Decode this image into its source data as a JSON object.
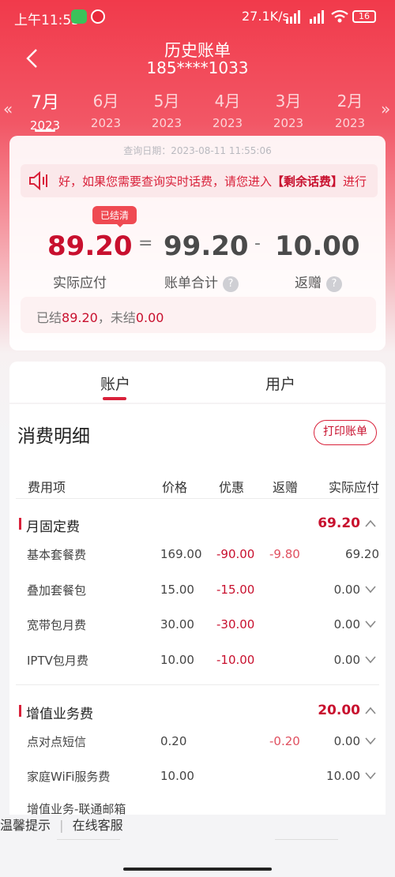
{
  "status_bar": {
    "time": "上午11:55",
    "speed": "27.1K/s",
    "battery": "16"
  },
  "header": {
    "title": "历史账单",
    "phone": "185****1033"
  },
  "months": [
    {
      "month": "7月",
      "year": "2023"
    },
    {
      "month": "6月",
      "year": "2023"
    },
    {
      "month": "5月",
      "year": "2023"
    },
    {
      "month": "4月",
      "year": "2023"
    },
    {
      "month": "3月",
      "year": "2023"
    },
    {
      "month": "2月",
      "year": "2023"
    }
  ],
  "summary": {
    "query_date": "查询日期：2023-08-11 11:55:06",
    "notice": "好，如果您需要查询实时话费，请您进入",
    "notice_link": "【剩余话费】",
    "notice_tail": "进行",
    "badge": "已结清",
    "actual": "89.20",
    "equals": "=",
    "total": "99.20",
    "minus": "-",
    "rebate": "10.00",
    "actual_label": "实际应付",
    "total_label": "账单合计",
    "rebate_label": "返赠",
    "settled_prefix": "已结",
    "settled_value": "89.20",
    "unsettled_prefix": "，未结",
    "unsettled_value": "0.00"
  },
  "tabs": {
    "account": "账户",
    "user": "用户"
  },
  "detail": {
    "title": "消费明细",
    "print_button": "打印账单",
    "columns": [
      "费用项",
      "价格",
      "优惠",
      "返赠",
      "实际应付"
    ],
    "sections": [
      {
        "name": "月固定费",
        "total": "69.20",
        "rows": [
          {
            "item": "基本套餐费",
            "price": "169.00",
            "discount": "-90.00",
            "rebate": "-9.80",
            "actual": "69.20"
          },
          {
            "item": "叠加套餐包",
            "price": "15.00",
            "discount": "-15.00",
            "rebate": "",
            "actual": "0.00"
          },
          {
            "item": "宽带包月费",
            "price": "30.00",
            "discount": "-30.00",
            "rebate": "",
            "actual": "0.00"
          },
          {
            "item": "IPTV包月费",
            "price": "10.00",
            "discount": "-10.00",
            "rebate": "",
            "actual": "0.00"
          }
        ]
      },
      {
        "name": "增值业务费",
        "total": "20.00",
        "rows": [
          {
            "item": "点对点短信",
            "price": "0.20",
            "discount": "",
            "rebate": "-0.20",
            "actual": "0.00"
          },
          {
            "item": "家庭WiFi服务费",
            "price": "10.00",
            "discount": "",
            "rebate": "",
            "actual": "10.00"
          },
          {
            "item": "增值业务-联通邮箱",
            "price": "",
            "discount": "",
            "rebate": "",
            "actual": ""
          }
        ]
      }
    ]
  },
  "footer": {
    "tips": "温馨提示",
    "divider": "|",
    "service": "在线客服"
  },
  "colors": {
    "brand_red": "#e9283b",
    "amount_red": "#c8102e",
    "header_red": "#f13a4b"
  }
}
